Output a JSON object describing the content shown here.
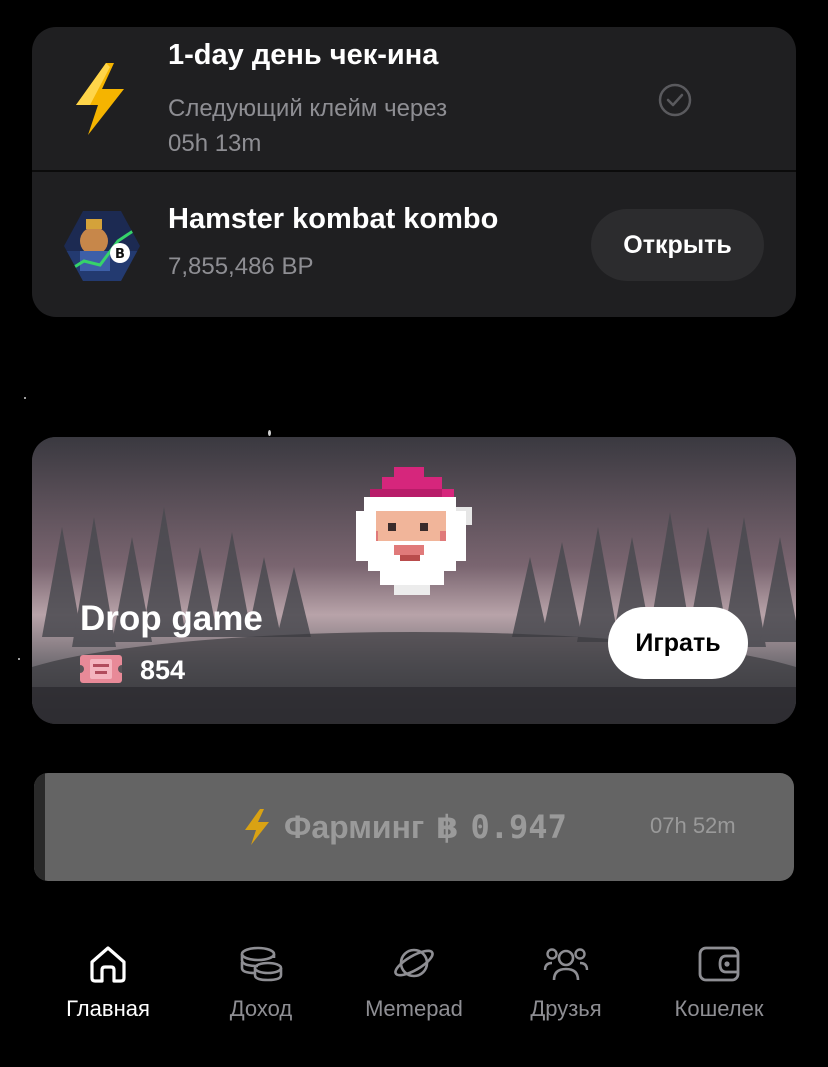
{
  "checkin": {
    "title": "1-day день чек-ина",
    "subtitle": "Следующий клейм через",
    "timer": "05h 13m"
  },
  "hamster": {
    "title": "Hamster kombat kombo",
    "points": "7,855,486 BP",
    "open_label": "Открыть"
  },
  "drop_game": {
    "title": "Drop game",
    "tickets": "854",
    "play_label": "Играть"
  },
  "farming": {
    "label": "Фарминг",
    "currency_symbol": "฿",
    "amount": "0.947",
    "timer": "07h 52m"
  },
  "nav": {
    "items": [
      {
        "label": "Главная",
        "icon": "home-icon",
        "active": true
      },
      {
        "label": "Доход",
        "icon": "coins-icon",
        "active": false
      },
      {
        "label": "Memepad",
        "icon": "planet-icon",
        "active": false
      },
      {
        "label": "Друзья",
        "icon": "friends-icon",
        "active": false
      },
      {
        "label": "Кошелек",
        "icon": "wallet-icon",
        "active": false
      }
    ]
  },
  "colors": {
    "background": "#000000",
    "card": "#1f1f21",
    "muted_text": "#8e8e93",
    "bolt": "#f5b400",
    "farm_bar": "#646464"
  }
}
